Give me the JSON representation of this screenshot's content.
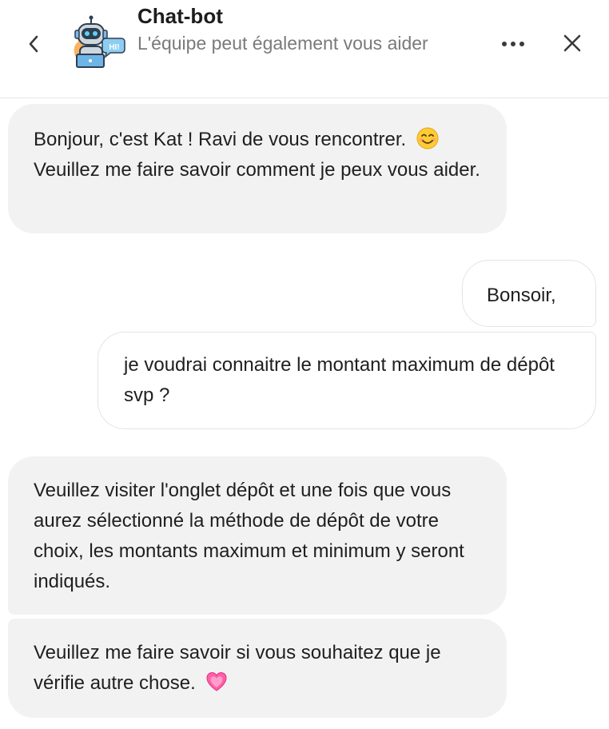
{
  "header": {
    "title": "Chat-bot",
    "subtitle": "L'équipe peut également vous aider",
    "avatar_badge": "HI!",
    "icons": {
      "back": "chevron-left-icon",
      "more": "more-dots-icon",
      "close": "close-icon"
    }
  },
  "messages": [
    {
      "sender": "bot",
      "text_before": "Bonjour, c'est Kat ! Ravi de vous rencontrer.",
      "emoji": "smiling-face-icon",
      "text_after": "Veuillez me faire savoir comment je peux vous aider."
    },
    {
      "sender": "user",
      "text": "Bonsoir,"
    },
    {
      "sender": "user",
      "text": "je voudrai connaitre le montant maximum de dépôt svp ?"
    },
    {
      "sender": "bot",
      "text": "Veuillez visiter l'onglet dépôt et une fois que vous aurez sélectionné la méthode de dépôt de votre choix, les montants maximum et minimum y seront indiqués."
    },
    {
      "sender": "bot",
      "text": "Veuillez me faire savoir si vous souhaitez que je vérifie autre chose.",
      "emoji": "pink-heart-icon"
    }
  ],
  "colors": {
    "bot_bubble": "#f2f2f2",
    "user_border": "#e4e4e4",
    "subtitle": "#7a7a7a"
  }
}
